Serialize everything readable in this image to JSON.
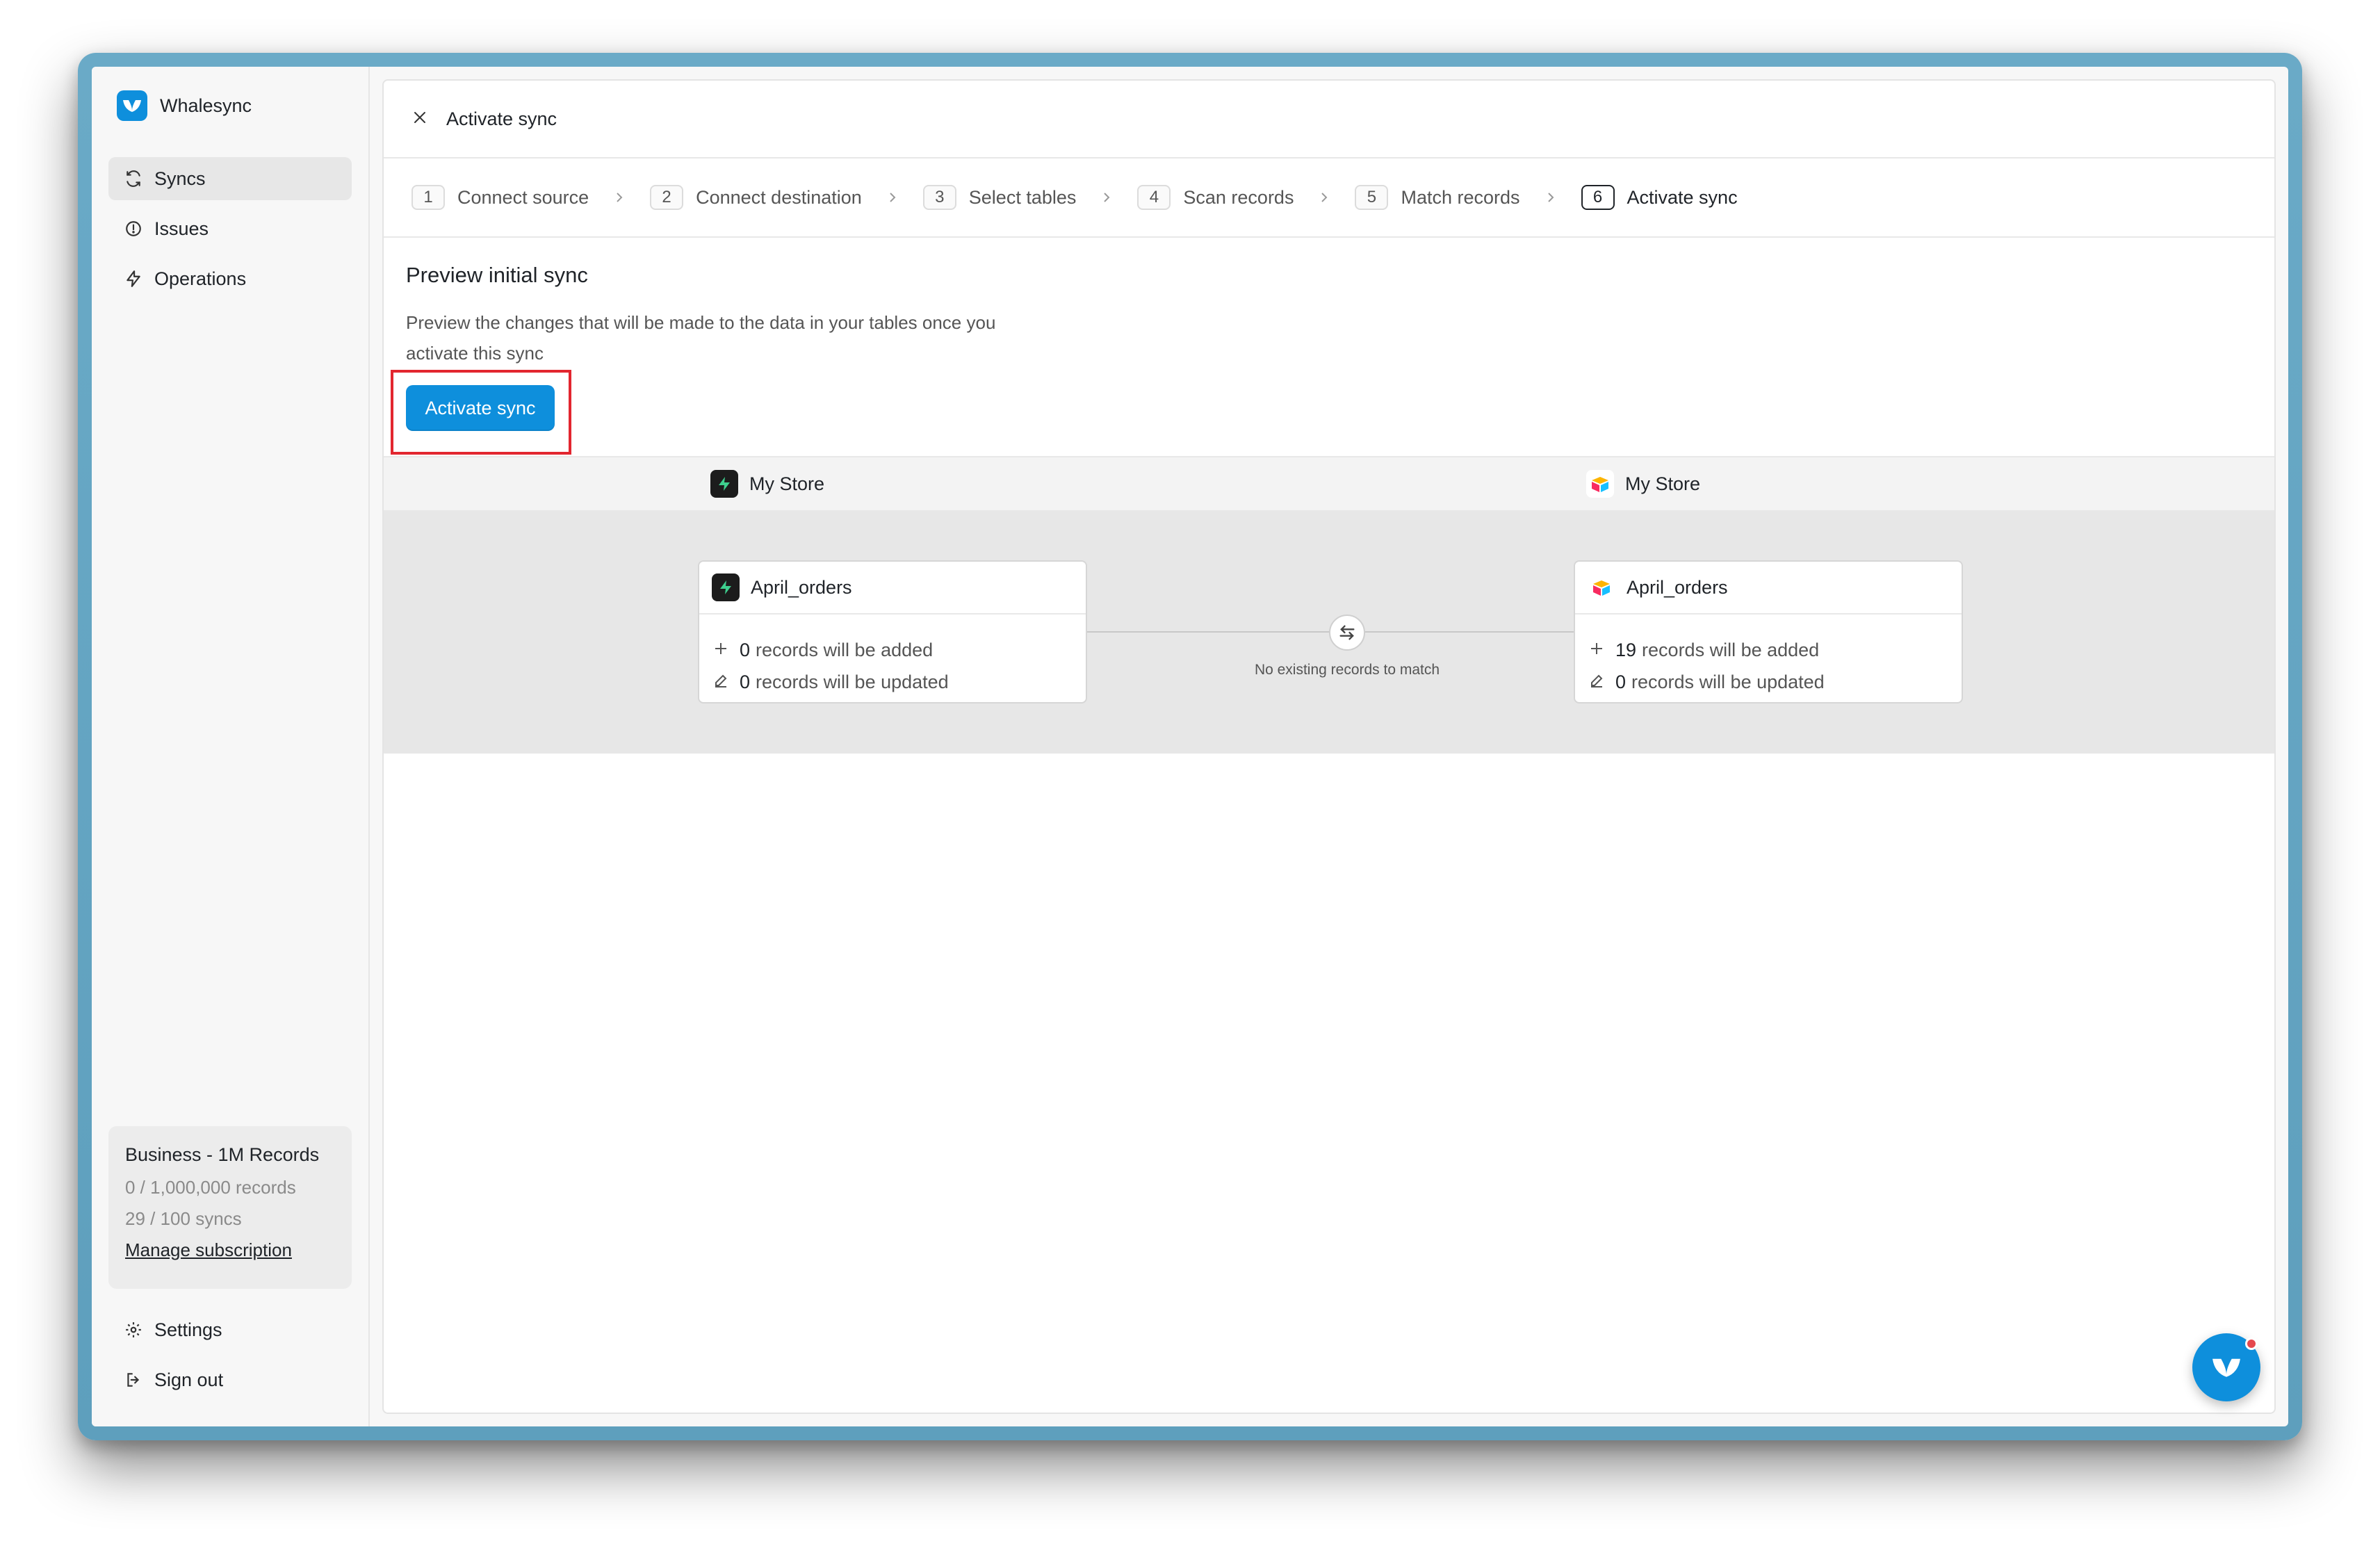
{
  "app": {
    "name": "Whalesync",
    "accent": "#0e8fdc",
    "highlight_color": "#e2262f"
  },
  "sidebar": {
    "items": [
      {
        "label": "Syncs",
        "icon": "refresh-icon",
        "active": true
      },
      {
        "label": "Issues",
        "icon": "alert-circle-icon",
        "active": false
      },
      {
        "label": "Operations",
        "icon": "bolt-icon",
        "active": false
      }
    ],
    "plan": {
      "title": "Business - 1M Records",
      "records": "0 / 1,000,000 records",
      "syncs": "29 / 100 syncs",
      "manage_label": "Manage subscription"
    },
    "bottom": [
      {
        "label": "Settings",
        "icon": "gear-icon"
      },
      {
        "label": "Sign out",
        "icon": "sign-out-icon"
      }
    ]
  },
  "header": {
    "title": "Activate sync"
  },
  "steps": [
    {
      "num": "1",
      "label": "Connect source"
    },
    {
      "num": "2",
      "label": "Connect destination"
    },
    {
      "num": "3",
      "label": "Select tables"
    },
    {
      "num": "4",
      "label": "Scan records"
    },
    {
      "num": "5",
      "label": "Match records"
    },
    {
      "num": "6",
      "label": "Activate sync",
      "current": true
    }
  ],
  "preview": {
    "title": "Preview initial sync",
    "description": "Preview the changes that will be made to the data in your tables once you activate this sync",
    "activate_label": "Activate sync"
  },
  "columns": {
    "left": {
      "store": "My Store",
      "app_icon": "supabase-icon",
      "table": "April_orders",
      "added_num": "0",
      "added_text": "records will be added",
      "updated_num": "0",
      "updated_text": "records will be updated"
    },
    "right": {
      "store": "My Store",
      "app_icon": "airtable-icon",
      "table": "April_orders",
      "added_num": "19",
      "added_text": "records will be added",
      "updated_num": "0",
      "updated_text": "records will be updated"
    },
    "match_label": "No existing records to match"
  }
}
